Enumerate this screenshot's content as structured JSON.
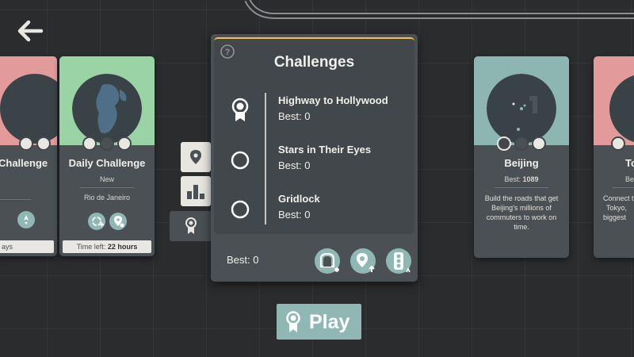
{
  "colors": {
    "background": "#2a2c2e",
    "card": "#4a5054",
    "panel_inner": "#41474b",
    "accent_teal": "#8fb8b4",
    "highlight_yellow": "#f2c24c",
    "card_green": "#9bd4a4",
    "card_pink": "#e39a9a",
    "card_teal": "#8db5b1"
  },
  "nav": {
    "back_icon": "left-arrow-icon"
  },
  "left_card": {
    "title": "Challenge",
    "timer": "ays",
    "button_icon": "rocket-icon"
  },
  "daily_card": {
    "title": "Daily Challenge",
    "status": "New",
    "city": "Rio de Janeiro",
    "timer_label": "Time left:",
    "timer_value": "22 hours",
    "button_icons": [
      "recycle-plus-icon",
      "map-pin-settings-icon"
    ]
  },
  "side_tabs": [
    {
      "icon": "map-pin-icon"
    },
    {
      "icon": "bar-chart-icon"
    },
    {
      "icon": "ribbon-icon"
    }
  ],
  "panel": {
    "title": "Challenges",
    "help_icon": "question-mark-icon",
    "challenges": [
      {
        "name": "Highway to Hollywood",
        "best": "Best: 0",
        "icon": "ribbon-icon"
      },
      {
        "name": "Stars in Their Eyes",
        "best": "Best: 0",
        "icon": "empty-circle-icon"
      },
      {
        "name": "Gridlock",
        "best": "Best: 0",
        "icon": "empty-circle-icon"
      }
    ],
    "best": "Best: 0",
    "buttons": [
      "tunnel-icon",
      "map-pin-upgrade-icon",
      "traffic-light-icon"
    ]
  },
  "beijing_card": {
    "title": "Beijing",
    "best_label": "Best:",
    "best_value": "1089",
    "description": "Build the roads that get Beijing's millions of commuters to work on time."
  },
  "right_card": {
    "title": "To",
    "best": "Be",
    "desc_lines": [
      "Connect t",
      "Tokyo,",
      "biggest"
    ]
  },
  "play": {
    "label": "Play",
    "icon": "ribbon-icon"
  }
}
